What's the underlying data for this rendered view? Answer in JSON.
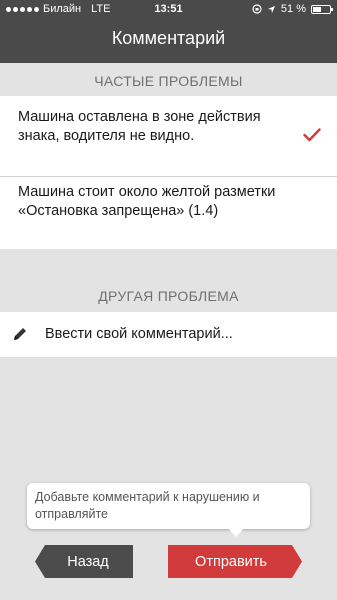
{
  "status_bar": {
    "carrier": "Билайн",
    "network": "LTE",
    "time": "13:51",
    "battery_text": "51 %",
    "battery_level": 0.51
  },
  "header": {
    "title": "Комментарий"
  },
  "common_section": {
    "title": "ЧАСТЫЕ ПРОБЛЕМЫ",
    "items": [
      {
        "label": "Машина оставлена в зоне действия знака, водителя не видно.",
        "selected": true
      },
      {
        "label": "Машина стоит около желтой разметки «Остановка запрещена» (1.4)",
        "selected": false
      }
    ]
  },
  "other_section": {
    "title": "ДРУГАЯ ПРОБЛЕМА",
    "input_placeholder": "Ввести свой комментарий..."
  },
  "tooltip": {
    "text": "Добавьте комментарий к нарушению и отправляйте"
  },
  "footer": {
    "back_label": "Назад",
    "send_label": "Отправить"
  },
  "colors": {
    "topbar": "#4a4a4a",
    "accent": "#d23b3b",
    "back_button": "#4c4c4c",
    "background": "#e3e3e3"
  }
}
